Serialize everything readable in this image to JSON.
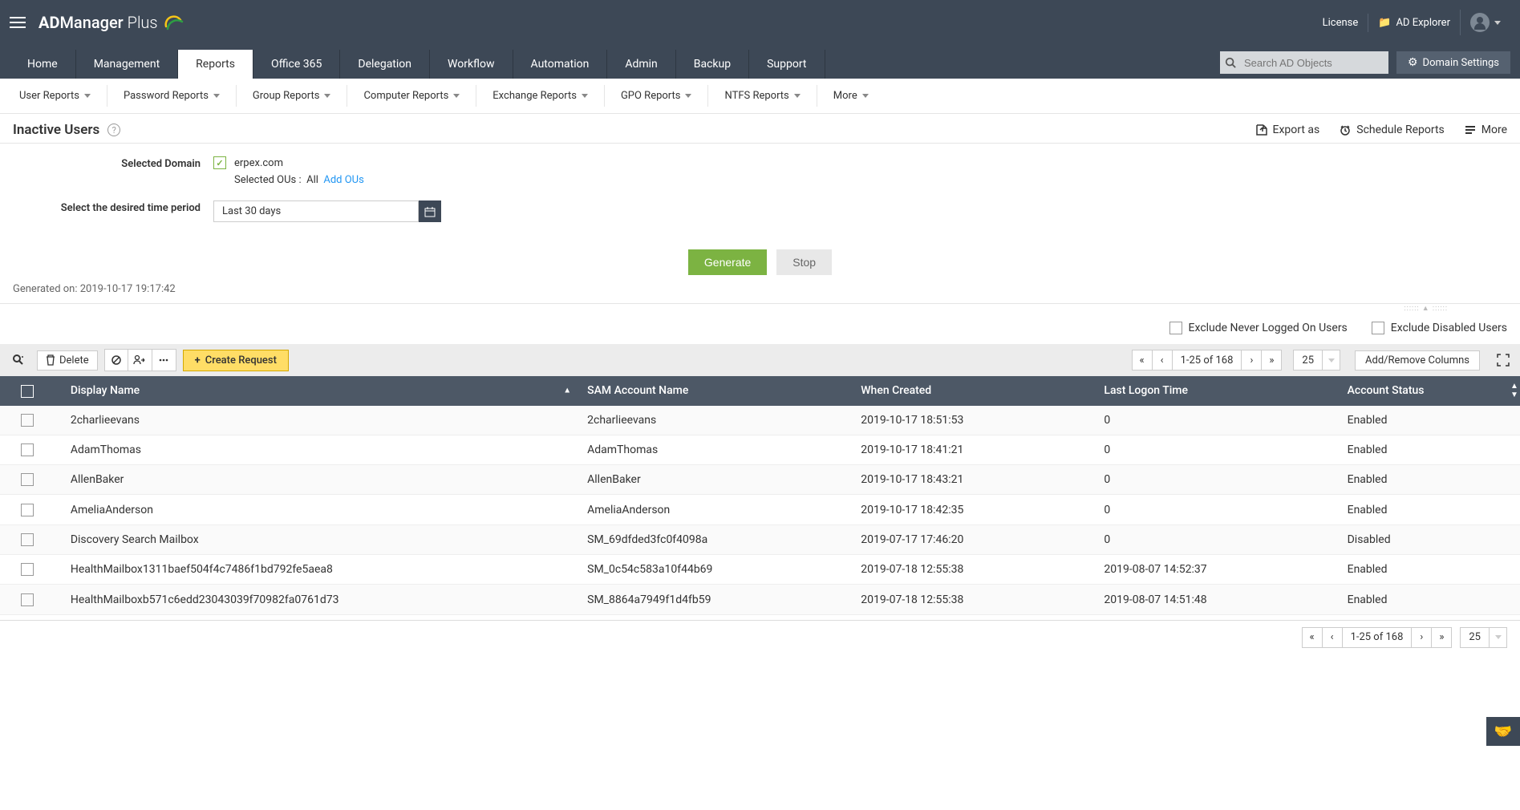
{
  "header": {
    "brand_pre": "AD",
    "brand_mid": "Manager",
    "brand_suf": " Plus",
    "license": "License",
    "adexplorer": "AD Explorer",
    "search_placeholder": "Search AD Objects",
    "domain_settings": "Domain Settings"
  },
  "main_tabs": [
    "Home",
    "Management",
    "Reports",
    "Office 365",
    "Delegation",
    "Workflow",
    "Automation",
    "Admin",
    "Backup",
    "Support"
  ],
  "active_tab_index": 2,
  "sub_tabs": [
    "User Reports",
    "Password Reports",
    "Group Reports",
    "Computer Reports",
    "Exchange Reports",
    "GPO Reports",
    "NTFS Reports",
    "More"
  ],
  "page": {
    "title": "Inactive Users",
    "export_as": "Export as",
    "schedule_reports": "Schedule Reports",
    "more": "More"
  },
  "form": {
    "selected_domain_label": "Selected Domain",
    "domain_value": "erpex.com",
    "selected_ous_label": "Selected OUs  :",
    "selected_ous_value": "All",
    "add_ous": "Add OUs",
    "time_period_label": "Select the desired time period",
    "time_period_value": "Last 30 days",
    "generate": "Generate",
    "stop": "Stop",
    "generated_on": "Generated on: 2019-10-17 19:17:42"
  },
  "filters": {
    "exclude_never": "Exclude Never Logged On Users",
    "exclude_disabled": "Exclude Disabled Users"
  },
  "toolbar": {
    "delete": "Delete",
    "create_request": "Create Request",
    "pager_text": "1-25 of 168",
    "page_size": "25",
    "add_remove_cols": "Add/Remove Columns"
  },
  "table": {
    "columns": [
      "Display Name",
      "SAM Account Name",
      "When Created",
      "Last Logon Time",
      "Account Status"
    ],
    "rows": [
      {
        "display": "2charlieevans",
        "sam": "2charlieevans",
        "created": "2019-10-17 18:51:53",
        "lastlogon": "0",
        "status": "Enabled"
      },
      {
        "display": "AdamThomas",
        "sam": "AdamThomas",
        "created": "2019-10-17 18:41:21",
        "lastlogon": "0",
        "status": "Enabled"
      },
      {
        "display": "AllenBaker",
        "sam": "AllenBaker",
        "created": "2019-10-17 18:43:21",
        "lastlogon": "0",
        "status": "Enabled"
      },
      {
        "display": "AmeliaAnderson",
        "sam": "AmeliaAnderson",
        "created": "2019-10-17 18:42:35",
        "lastlogon": "0",
        "status": "Enabled"
      },
      {
        "display": "Discovery Search Mailbox",
        "sam": "SM_69dfded3fc0f4098a",
        "created": "2019-07-17 17:46:20",
        "lastlogon": "0",
        "status": "Disabled"
      },
      {
        "display": "HealthMailbox1311baef504f4c7486f1bd792fe5aea8",
        "sam": "SM_0c54c583a10f44b69",
        "created": "2019-07-18 12:55:38",
        "lastlogon": "2019-08-07 14:52:37",
        "status": "Enabled"
      },
      {
        "display": "HealthMailboxb571c6edd23043039f70982fa0761d73",
        "sam": "SM_8864a7949f1d4fb59",
        "created": "2019-07-18 12:55:38",
        "lastlogon": "2019-08-07 14:51:48",
        "status": "Enabled"
      }
    ]
  },
  "bottom_pager": {
    "text": "1-25 of 168",
    "page_size": "25"
  }
}
